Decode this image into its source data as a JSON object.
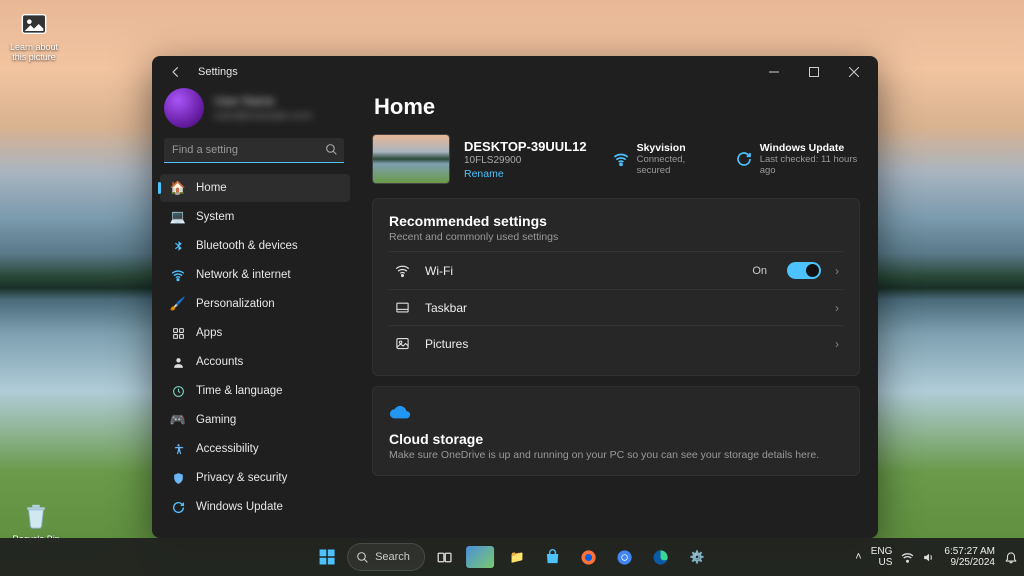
{
  "desktop": {
    "learn_about": "Learn about this picture",
    "recycle_bin": "Recycle Bin"
  },
  "window": {
    "title": "Settings",
    "account_name": "User Name",
    "account_email": "user@example.com",
    "search_placeholder": "Find a setting"
  },
  "nav": {
    "home": "Home",
    "system": "System",
    "bluetooth": "Bluetooth & devices",
    "network": "Network & internet",
    "personalization": "Personalization",
    "apps": "Apps",
    "accounts": "Accounts",
    "time": "Time & language",
    "gaming": "Gaming",
    "accessibility": "Accessibility",
    "privacy": "Privacy & security",
    "update": "Windows Update"
  },
  "main": {
    "heading": "Home",
    "device_name": "DESKTOP-39UUL12",
    "device_model": "10FLS29900",
    "rename": "Rename",
    "wifi_name": "Skyvision",
    "wifi_status": "Connected, secured",
    "update_title": "Windows Update",
    "update_status": "Last checked: 11 hours ago",
    "rec_title": "Recommended settings",
    "rec_sub": "Recent and commonly used settings",
    "row_wifi": "Wi-Fi",
    "row_wifi_state": "On",
    "row_taskbar": "Taskbar",
    "row_pictures": "Pictures",
    "cloud_title": "Cloud storage",
    "cloud_sub": "Make sure OneDrive is up and running on your PC so you can see your storage details here."
  },
  "taskbar": {
    "search": "Search",
    "lang1": "ENG",
    "lang2": "US",
    "time": "6:57:27 AM",
    "date": "9/25/2024"
  }
}
